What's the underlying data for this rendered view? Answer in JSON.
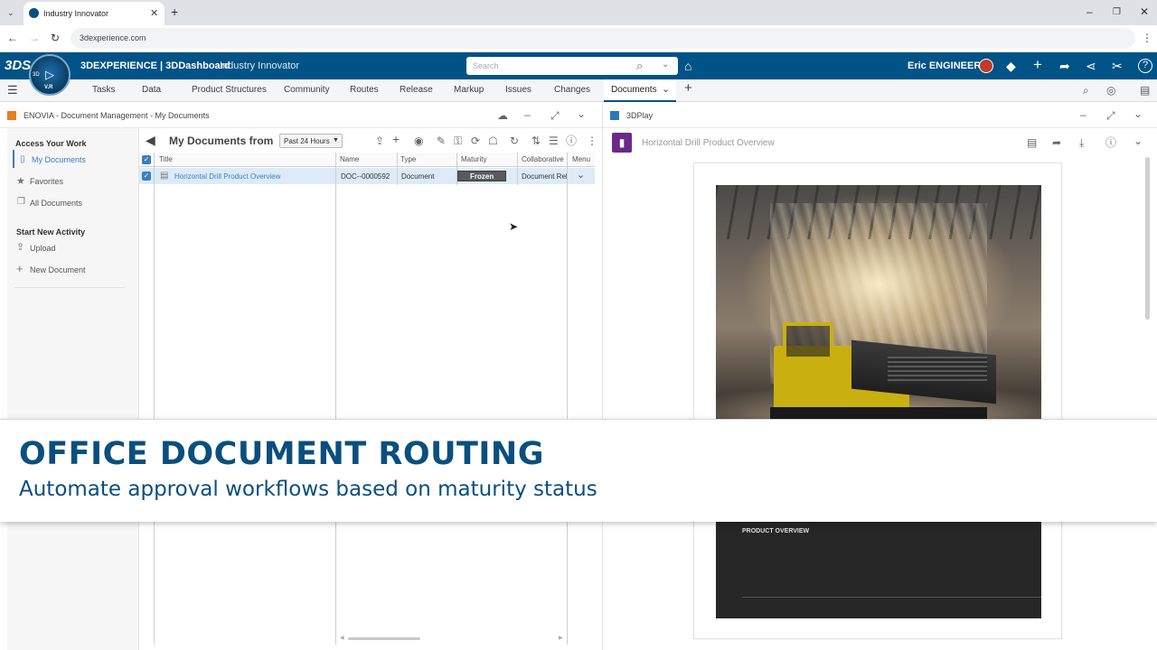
{
  "browser": {
    "tab_title": "Industry Innovator",
    "url": "3dexperience.com"
  },
  "topbar": {
    "brand": "3DEXPERIENCE | 3DDashboard",
    "app_name": "Industry Innovator",
    "search_placeholder": "Search",
    "user_name": "Eric ENGINEER",
    "compass_top": "3D",
    "compass_bottom": "V.R"
  },
  "nav_tabs": [
    "Tasks",
    "Data",
    "Product Structures",
    "Community",
    "Routes",
    "Release",
    "Markup",
    "Issues",
    "Changes",
    "Documents"
  ],
  "left_panel": {
    "title": "ENOVIA - Document Management - My Documents",
    "section_access": "Access Your Work",
    "items_access": [
      "My Documents",
      "Favorites",
      "All Documents"
    ],
    "section_new": "Start New Activity",
    "items_new": [
      "Upload",
      "New Document"
    ],
    "view_title": "My Documents from",
    "filter_value": "Past 24 Hours",
    "columns": [
      "Title",
      "Name",
      "Type",
      "Maturity",
      "Collaborative",
      "Menu"
    ],
    "rows": [
      {
        "title": "Horizontal Drill Product Overview",
        "name": "DOC--0000592",
        "type": "Document",
        "maturity": "Frozen",
        "collaborative": "Document Rel"
      }
    ]
  },
  "right_panel": {
    "app_title": "3DPlay",
    "doc_title": "Horizontal Drill Product Overview",
    "dark_block_caption": "PRODUCT OVERVIEW"
  },
  "banner": {
    "title": "OFFICE DOCUMENT ROUTING",
    "subtitle": "Automate approval workflows based on maturity status"
  },
  "colors": {
    "topbar": "#005386",
    "banner_text": "#0a4f7e",
    "frozen_badge": "#5a5a5a",
    "selected_row": "#dcebf7",
    "link": "#3a7fc1"
  }
}
